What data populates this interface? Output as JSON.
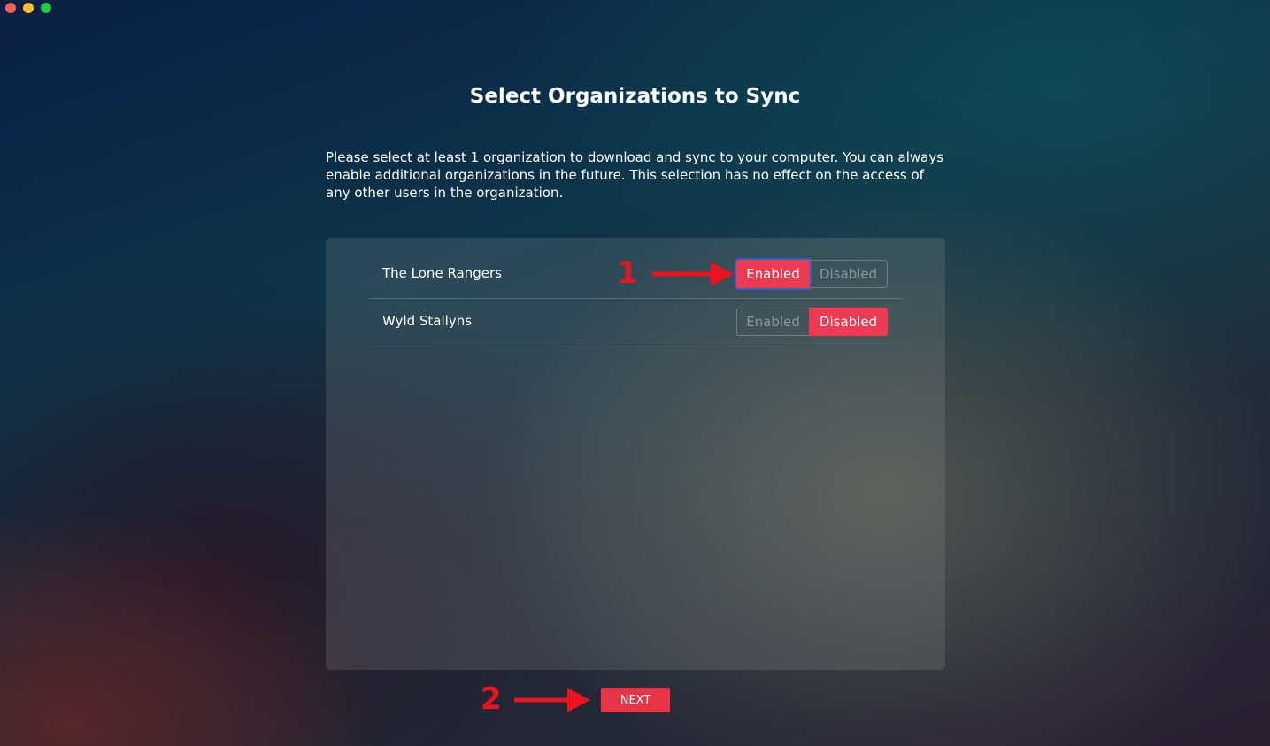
{
  "window": {
    "controls": {
      "close_color": "#fe5f57",
      "minimize_color": "#febc2e",
      "zoom_color": "#28c840"
    }
  },
  "page": {
    "title": "Select Organizations to Sync",
    "description": "Please select at least 1 organization to download and sync to your computer. You can always enable additional organizations in the future. This selection has no effect on the access of any other users in the organization."
  },
  "organizations": [
    {
      "name": "The Lone Rangers",
      "enabled_label": "Enabled",
      "disabled_label": "Disabled",
      "state": "enabled"
    },
    {
      "name": "Wyld Stallyns",
      "enabled_label": "Enabled",
      "disabled_label": "Disabled",
      "state": "disabled"
    }
  ],
  "next_button": {
    "label": "NEXT"
  },
  "annotations": [
    {
      "number": "1",
      "icon": "arrow-right-icon",
      "color": "#e8141f"
    },
    {
      "number": "2",
      "icon": "arrow-right-icon",
      "color": "#e8141f"
    }
  ],
  "colors": {
    "accent": "#ee3b54",
    "focus_ring": "#2e62c9"
  }
}
